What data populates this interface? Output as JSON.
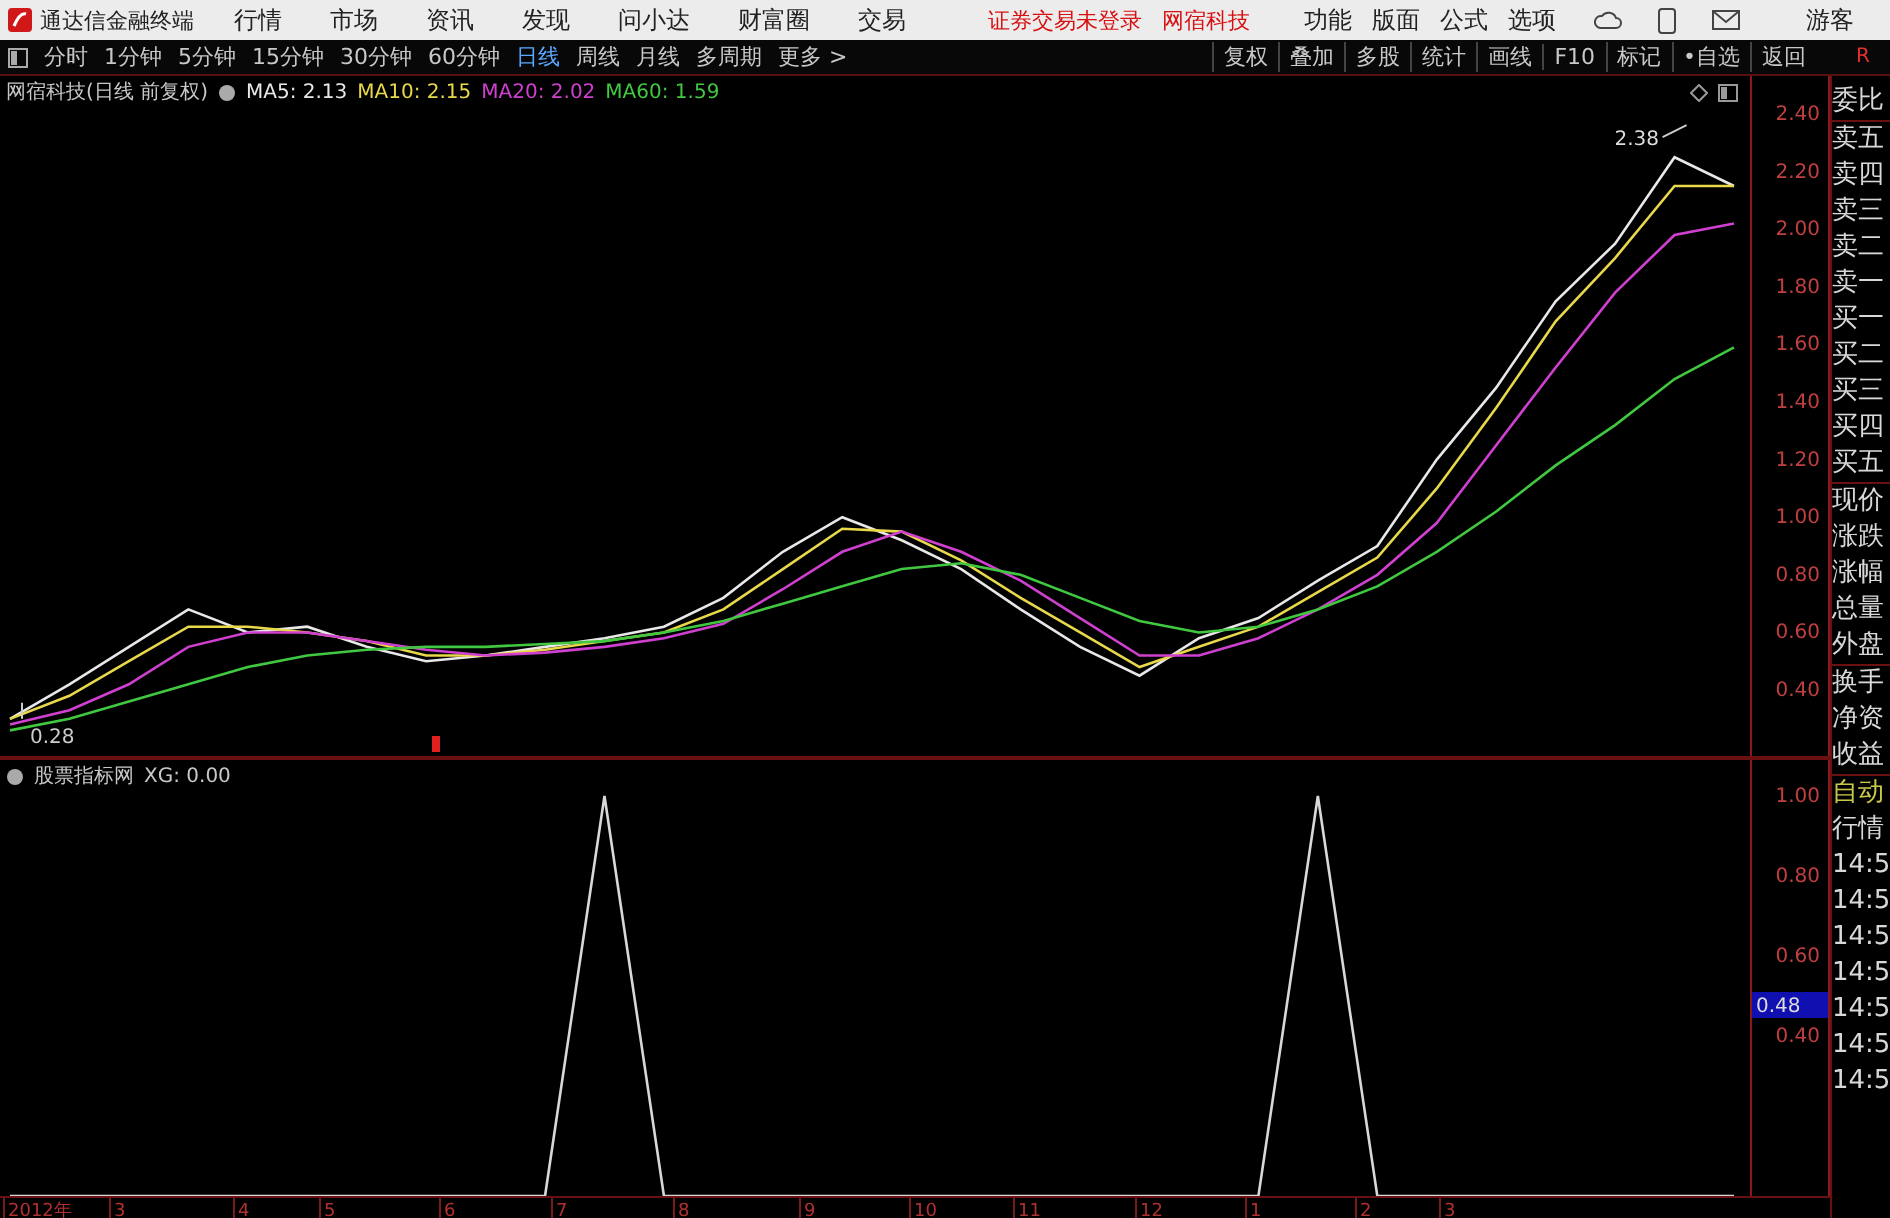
{
  "app": {
    "title": "通达信金融终端",
    "menu": [
      "行情",
      "市场",
      "资讯",
      "发现",
      "问小达",
      "财富圈",
      "交易"
    ],
    "notices": [
      "证券交易未登录",
      "网宿科技"
    ],
    "tools": [
      "功能",
      "版面",
      "公式",
      "选项"
    ],
    "user": "游客"
  },
  "toolbar": {
    "periods": [
      {
        "label": "分时",
        "selected": false
      },
      {
        "label": "1分钟",
        "selected": false
      },
      {
        "label": "5分钟",
        "selected": false
      },
      {
        "label": "15分钟",
        "selected": false
      },
      {
        "label": "30分钟",
        "selected": false
      },
      {
        "label": "60分钟",
        "selected": false
      },
      {
        "label": "日线",
        "selected": true
      },
      {
        "label": "周线",
        "selected": false
      },
      {
        "label": "月线",
        "selected": false
      },
      {
        "label": "多周期",
        "selected": false
      },
      {
        "label": "更多 >",
        "selected": false
      }
    ],
    "actions": [
      "复权",
      "叠加",
      "多股",
      "统计",
      "画线",
      "F10",
      "标记",
      "•自选",
      "返回"
    ],
    "corner": "R"
  },
  "price_panel": {
    "title": "网宿科技(日线 前复权)",
    "readings": [
      ": 2.13",
      ": 2.15",
      ": 2.02",
      ": 1.59"
    ],
    "chart_data": {
      "type": "line",
      "categories": [
        null,
        null,
        null,
        null,
        null,
        null,
        null,
        null,
        null,
        null,
        null,
        null,
        null,
        null,
        null,
        null,
        null,
        null,
        null,
        null,
        null,
        null,
        null,
        null,
        null,
        null,
        null,
        null,
        null,
        null
      ],
      "ylim": [
        0.171,
        2.532
      ],
      "yticks": [
        {
          "value": 0.4,
          "label": "0.40"
        },
        {
          "value": 0.6,
          "label": "0.60"
        },
        {
          "value": 0.8,
          "label": "0.80"
        },
        {
          "value": 1.0,
          "label": "1.00"
        },
        {
          "value": 1.2,
          "label": "1.20"
        },
        {
          "value": 1.4,
          "label": "1.40"
        },
        {
          "value": 1.6,
          "label": "1.60"
        },
        {
          "value": 1.8,
          "label": "1.80"
        },
        {
          "value": 2.0,
          "label": "2.00"
        },
        {
          "value": 2.2,
          "label": "2.20"
        },
        {
          "value": 2.4,
          "label": "2.40"
        }
      ],
      "series": [
        {
          "name": "MA5",
          "color": "#e8e8e8",
          "values": [
            0.3,
            0.42,
            0.55,
            0.68,
            0.6,
            0.62,
            0.55,
            0.5,
            0.52,
            0.55,
            0.58,
            0.62,
            0.72,
            0.88,
            1.0,
            0.92,
            0.82,
            0.68,
            0.55,
            0.45,
            0.58,
            0.65,
            0.78,
            0.9,
            1.2,
            1.45,
            1.75,
            1.95,
            2.25,
            2.15
          ]
        },
        {
          "name": "MA10",
          "color": "#e8d84a",
          "values": [
            0.3,
            0.38,
            0.5,
            0.62,
            0.62,
            0.6,
            0.57,
            0.52,
            0.52,
            0.54,
            0.57,
            0.6,
            0.68,
            0.82,
            0.96,
            0.95,
            0.85,
            0.72,
            0.6,
            0.48,
            0.55,
            0.62,
            0.74,
            0.86,
            1.1,
            1.38,
            1.68,
            1.9,
            2.15,
            2.15
          ]
        },
        {
          "name": "MA20",
          "color": "#d040d0",
          "values": [
            0.28,
            0.33,
            0.42,
            0.55,
            0.6,
            0.6,
            0.57,
            0.54,
            0.52,
            0.53,
            0.55,
            0.58,
            0.63,
            0.75,
            0.88,
            0.95,
            0.88,
            0.78,
            0.65,
            0.52,
            0.52,
            0.58,
            0.68,
            0.8,
            0.98,
            1.25,
            1.52,
            1.78,
            1.98,
            2.02
          ]
        },
        {
          "name": "MA60",
          "color": "#40c840",
          "values": [
            0.26,
            0.3,
            0.36,
            0.42,
            0.48,
            0.52,
            0.54,
            0.55,
            0.55,
            0.56,
            0.57,
            0.6,
            0.64,
            0.7,
            0.76,
            0.82,
            0.84,
            0.8,
            0.72,
            0.64,
            0.6,
            0.62,
            0.68,
            0.76,
            0.88,
            1.02,
            1.18,
            1.32,
            1.48,
            1.59
          ]
        }
      ],
      "annotations": [
        {
          "text": "2.38"
        },
        {
          "text": "0.28"
        }
      ]
    }
  },
  "indicator_panel": {
    "title": "股票指标网",
    "reading": ": 0.00",
    "cursor_label": "0.48",
    "chart_data": {
      "type": "line",
      "categories": [
        null,
        null,
        null,
        null,
        null,
        null,
        null,
        null,
        null,
        null,
        null,
        null,
        null,
        null,
        null,
        null,
        null,
        null,
        null,
        null,
        null,
        null,
        null,
        null,
        null,
        null,
        null,
        null,
        null,
        null
      ],
      "ylim": [
        0,
        1.09
      ],
      "yticks": [
        {
          "value": 0.4,
          "label": "0.40"
        },
        {
          "value": 0.6,
          "label": "0.60"
        },
        {
          "value": 0.8,
          "label": "0.80"
        },
        {
          "value": 1.0,
          "label": "1.00"
        }
      ],
      "series": [
        {
          "name": "XG",
          "color": "#d8d8d8",
          "values": [
            0,
            0,
            0,
            0,
            0,
            0,
            0,
            0,
            0,
            0,
            1,
            0,
            0,
            0,
            0,
            0,
            0,
            0,
            0,
            0,
            0,
            0,
            1,
            0,
            0,
            0,
            0,
            0,
            0,
            0
          ]
        }
      ]
    }
  },
  "time_axis": [
    "2012年",
    "3",
    "4",
    "5",
    "6",
    "7",
    "8",
    "9",
    "10",
    "11",
    "12",
    "1",
    "2",
    "3"
  ],
  "side_panel": {
    "groups": [
      [
        "委比"
      ],
      [
        "卖五",
        "卖四",
        "卖三",
        "卖二",
        "卖一",
        "买一",
        "买二",
        "买三",
        "买四",
        "买五"
      ],
      [
        "现价",
        "涨跌",
        "涨幅",
        "总量",
        "外盘"
      ],
      [
        "换手",
        "净资",
        "收益"
      ]
    ],
    "auto": [
      "自动",
      "行情"
    ],
    "times": [
      "14:5",
      "14:5",
      "14:5",
      "14:5",
      "14:5",
      "14:5",
      "14:5"
    ]
  }
}
